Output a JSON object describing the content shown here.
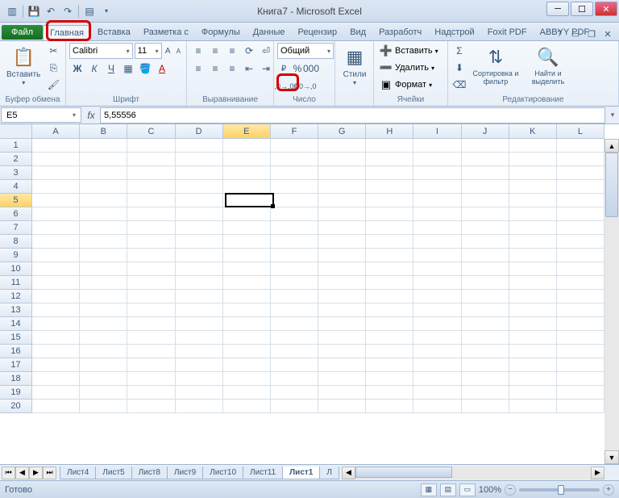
{
  "title": "Книга7 - Microsoft Excel",
  "tabs": {
    "file": "Файл",
    "items": [
      "Главная",
      "Вставка",
      "Разметка с",
      "Формулы",
      "Данные",
      "Рецензир",
      "Вид",
      "Разработч",
      "Надстрой",
      "Foxit PDF",
      "ABBYY PDF"
    ],
    "active_index": 0
  },
  "ribbon": {
    "clipboard": {
      "label": "Буфер обмена",
      "paste": "Вставить"
    },
    "font": {
      "label": "Шрифт",
      "name": "Calibri",
      "size": "11"
    },
    "alignment": {
      "label": "Выравнивание"
    },
    "number": {
      "label": "Число",
      "format": "Общий"
    },
    "styles": {
      "label": "Стили",
      "btn": "Стили"
    },
    "cells": {
      "label": "Ячейки",
      "insert": "Вставить",
      "delete": "Удалить",
      "format": "Формат"
    },
    "editing": {
      "label": "Редактирование",
      "sort": "Сортировка и фильтр",
      "find": "Найти и выделить"
    }
  },
  "name_box": "E5",
  "formula_value": "5,55556",
  "columns": [
    "A",
    "B",
    "C",
    "D",
    "E",
    "F",
    "G",
    "H",
    "I",
    "J",
    "K",
    "L"
  ],
  "rows_count": 20,
  "selected": {
    "col_index": 4,
    "row_index": 4,
    "value": "5,55556"
  },
  "sheets": {
    "list": [
      "Лист4",
      "Лист5",
      "Лист8",
      "Лист9",
      "Лист10",
      "Лист11",
      "Лист1",
      "Л"
    ],
    "active_index": 6
  },
  "status": {
    "ready": "Готово",
    "zoom": "100%"
  }
}
